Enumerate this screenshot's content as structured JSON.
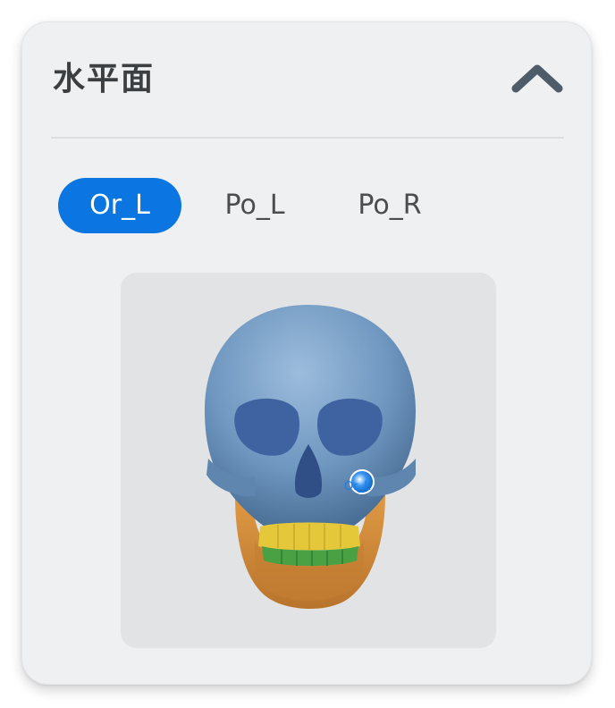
{
  "panel": {
    "title": "水平面",
    "collapse_icon": "chevron-up-icon"
  },
  "tabs": [
    {
      "label": "Or_L",
      "active": true
    },
    {
      "label": "Po_L",
      "active": false
    },
    {
      "label": "Po_R",
      "active": false
    }
  ],
  "viewer": {
    "landmark_label": "Or_L",
    "colors": {
      "skull": "#6f97c0",
      "mandible": "#d08a3a",
      "upper_teeth": "#e4c83a",
      "lower_teeth": "#49a144",
      "landmark": "#1a7de8"
    }
  }
}
